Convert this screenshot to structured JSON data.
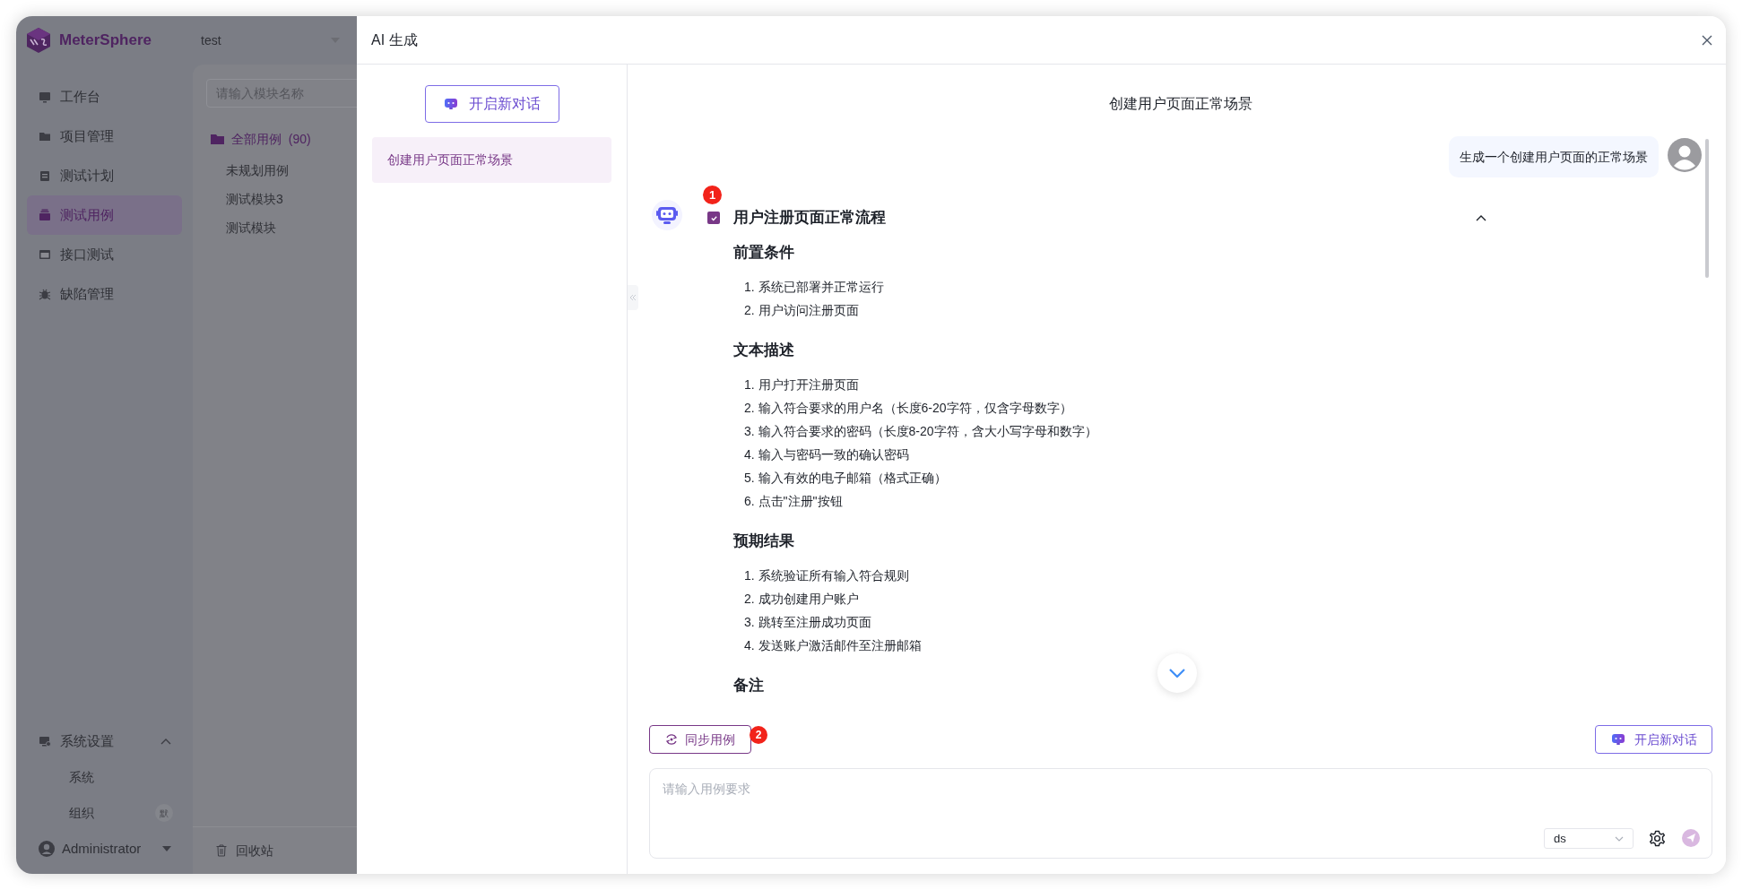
{
  "app": {
    "logo": "MeterSphere",
    "project": "test"
  },
  "nav": [
    {
      "label": "工作台",
      "selected": false
    },
    {
      "label": "项目管理",
      "selected": false
    },
    {
      "label": "测试计划",
      "selected": false
    },
    {
      "label": "测试用例",
      "selected": true
    },
    {
      "label": "接口测试",
      "selected": false
    },
    {
      "label": "缺陷管理",
      "selected": false
    }
  ],
  "settings": {
    "label": "系统设置",
    "expanded": true,
    "children": [
      {
        "label": "系统"
      },
      {
        "label": "组织",
        "badge": "默"
      }
    ]
  },
  "user": {
    "name": "Administrator"
  },
  "module_search": {
    "placeholder": "请输入模块名称"
  },
  "module_tree": [
    {
      "label": "全部用例",
      "count": "(90)",
      "selected": true,
      "children": [
        {
          "label": "未规划用例",
          "selected": false
        },
        {
          "label": "测试模块3",
          "selected": false
        },
        {
          "label": "测试模块",
          "selected": false
        }
      ]
    }
  ],
  "recycle_bin": "回收站",
  "drawer": {
    "title": "AI 生成"
  },
  "history_panel": {
    "new_chat_button": "开启新对话",
    "items": [
      {
        "title": "创建用户页面正常场景",
        "selected": true
      }
    ]
  },
  "chat": {
    "title": "创建用户页面正常场景",
    "messages": [
      {
        "kind": "user",
        "text": "生成一个创建用户页面的正常场景"
      },
      {
        "kind": "bot",
        "badge": "1",
        "checked": true,
        "title": "用户注册页面正常流程",
        "expanded": true,
        "sections": [
          {
            "heading": "前置条件",
            "items": [
              "1. 系统已部署并正常运行",
              "2. 用户访问注册页面"
            ]
          },
          {
            "heading": "文本描述",
            "items": [
              "1. 用户打开注册页面",
              "2. 输入符合要求的用户名（长度6-20字符，仅含字母数字）",
              "3. 输入符合要求的密码（长度8-20字符，含大小写字母和数字）",
              "4. 输入与密码一致的确认密码",
              "5. 输入有效的电子邮箱（格式正确）",
              "6. 点击\"注册\"按钮"
            ]
          },
          {
            "heading": "预期结果",
            "items": [
              "1. 系统验证所有输入符合规则",
              "2. 成功创建用户账户",
              "3. 跳转至注册成功页面",
              "4. 发送账户激活邮件至注册邮箱"
            ]
          },
          {
            "heading": "备注"
          }
        ]
      }
    ]
  },
  "actions": {
    "sync_button": "同步用例",
    "sync_badge": "2",
    "new_chat_button": "开启新对话"
  },
  "composer": {
    "placeholder": "请输入用例要求",
    "model": "ds"
  }
}
